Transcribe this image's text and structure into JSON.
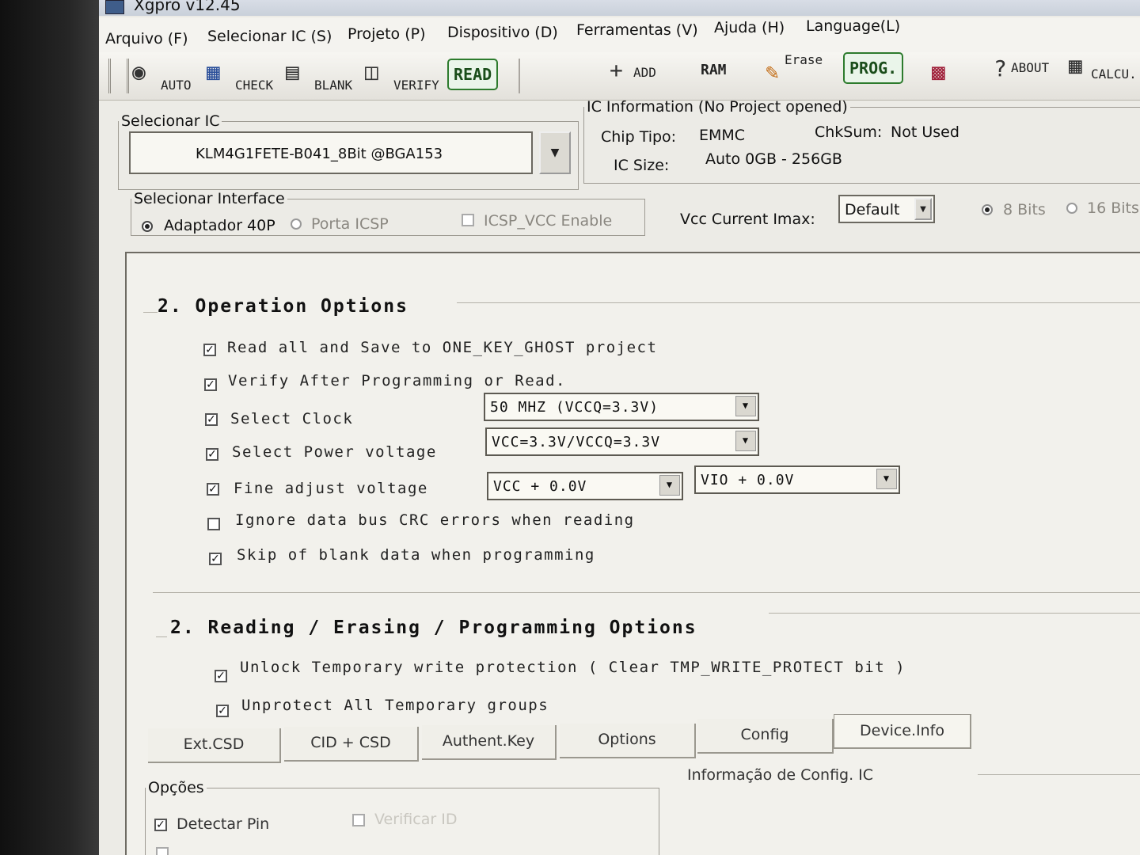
{
  "window": {
    "title": "Xgpro v12.45"
  },
  "menu": [
    "Arquivo (F)",
    "Selecionar IC (S)",
    "Projeto (P)",
    "Dispositivo (D)",
    "Ferramentas (V)",
    "Ajuda (H)",
    "Language(L)"
  ],
  "toolbar": {
    "auto": "AUTO",
    "check": "CHECK",
    "blank": "BLANK",
    "verify": "VERIFY",
    "read": "READ",
    "add": "ADD",
    "ram": "RAM",
    "erase": "Erase",
    "prog": "PROG.",
    "about": "ABOUT",
    "calcu": "CALCU."
  },
  "select_ic": {
    "legend": "Selecionar IC",
    "value": "KLM4G1FETE-B041_8Bit @BGA153"
  },
  "ic_info": {
    "legend": "IC Information (No Project opened)",
    "chip_tipo_label": "Chip Tipo:",
    "chip_tipo_value": "EMMC",
    "chksum_label": "ChkSum:",
    "chksum_value": "Not Used",
    "ic_size_label": "IC Size:",
    "ic_size_value": "Auto 0GB - 256GB"
  },
  "interface": {
    "legend": "Selecionar Interface",
    "adaptador": "Adaptador 40P",
    "porta_icsp": "Porta ICSP",
    "icsp_vcc": "ICSP_VCC Enable",
    "selected": "Adaptador 40P"
  },
  "vcc": {
    "label": "Vcc Current Imax:",
    "value": "Default"
  },
  "bits": {
    "opt8": "8 Bits",
    "opt16": "16 Bits",
    "selected": "8 Bits"
  },
  "operation": {
    "title": "2. Operation Options",
    "read_all": {
      "label": "Read all and Save to ONE_KEY_GHOST project",
      "checked": true
    },
    "verify_after": {
      "label": "Verify After Programming or Read.",
      "checked": true
    },
    "select_clock": {
      "label": "Select Clock",
      "checked": true,
      "value": "50 MHZ (VCCQ=3.3V)"
    },
    "select_power": {
      "label": "Select Power voltage",
      "checked": true,
      "value": "VCC=3.3V/VCCQ=3.3V"
    },
    "fine_adjust": {
      "label": "Fine adjust voltage",
      "checked": true,
      "vcc_value": "VCC + 0.0V",
      "vio_value": "VIO + 0.0V"
    },
    "ignore_crc": {
      "label": "Ignore data bus CRC errors when reading",
      "checked": false
    },
    "skip_blank": {
      "label": "Skip of blank data when programming",
      "checked": true
    }
  },
  "rep": {
    "title": "2. Reading / Erasing / Programming Options",
    "unlock": {
      "label": "Unlock Temporary write protection ( Clear TMP_WRITE_PROTECT bit )",
      "checked": true
    },
    "unprotect": {
      "label": "Unprotect All Temporary groups",
      "checked": true
    }
  },
  "tabs": [
    "Ext.CSD",
    "CID + CSD",
    "Authent.Key",
    "Options",
    "Config",
    "Device.Info"
  ],
  "opcoes": {
    "legend": "Opções",
    "detectar_pin": "Detectar Pin",
    "verificar_id": "Verificar ID"
  },
  "config_info": {
    "label": "Informação de Config. IC"
  }
}
